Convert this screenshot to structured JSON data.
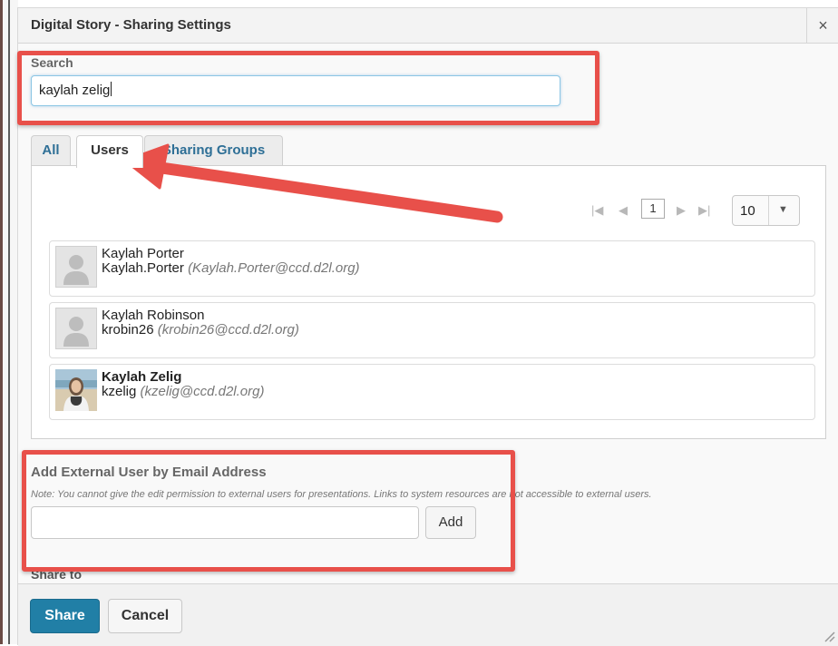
{
  "dialog": {
    "title": "Digital Story - Sharing Settings",
    "close_glyph": "×"
  },
  "search": {
    "label": "Search",
    "value": "kaylah zelig"
  },
  "tabs": [
    {
      "label": "All"
    },
    {
      "label": "Users",
      "selected": true
    },
    {
      "label": "Sharing Groups"
    }
  ],
  "pager": {
    "current_page": "1",
    "page_size": "10",
    "icons": [
      "first-page-icon",
      "prev-page-icon",
      "next-page-icon",
      "last-page-icon"
    ]
  },
  "users": [
    {
      "name": "Kaylah Porter",
      "login": "Kaylah.Porter",
      "email": "(Kaylah.Porter@ccd.d2l.org)",
      "avatar": "placeholder-avatar-icon"
    },
    {
      "name": "Kaylah Robinson",
      "login": "krobin26",
      "email": "(krobin26@ccd.d2l.org)",
      "avatar": "placeholder-avatar-icon"
    },
    {
      "name": "Kaylah Zelig",
      "login": "kzelig",
      "email": "(kzelig@ccd.d2l.org)",
      "avatar": "profile-photo"
    }
  ],
  "external": {
    "label": "Add External User by Email Address",
    "note": "Note: You cannot give the edit permission to external users for presentations. Links to system resources are not accessible to external users.",
    "email_value": "",
    "add_label": "Add"
  },
  "share_to_label": "Share to",
  "footer": {
    "share_label": "Share",
    "cancel_label": "Cancel"
  },
  "colors": {
    "highlight": "#e8504a",
    "primary_button": "#217fa6",
    "tab_link": "#2e6f96"
  }
}
